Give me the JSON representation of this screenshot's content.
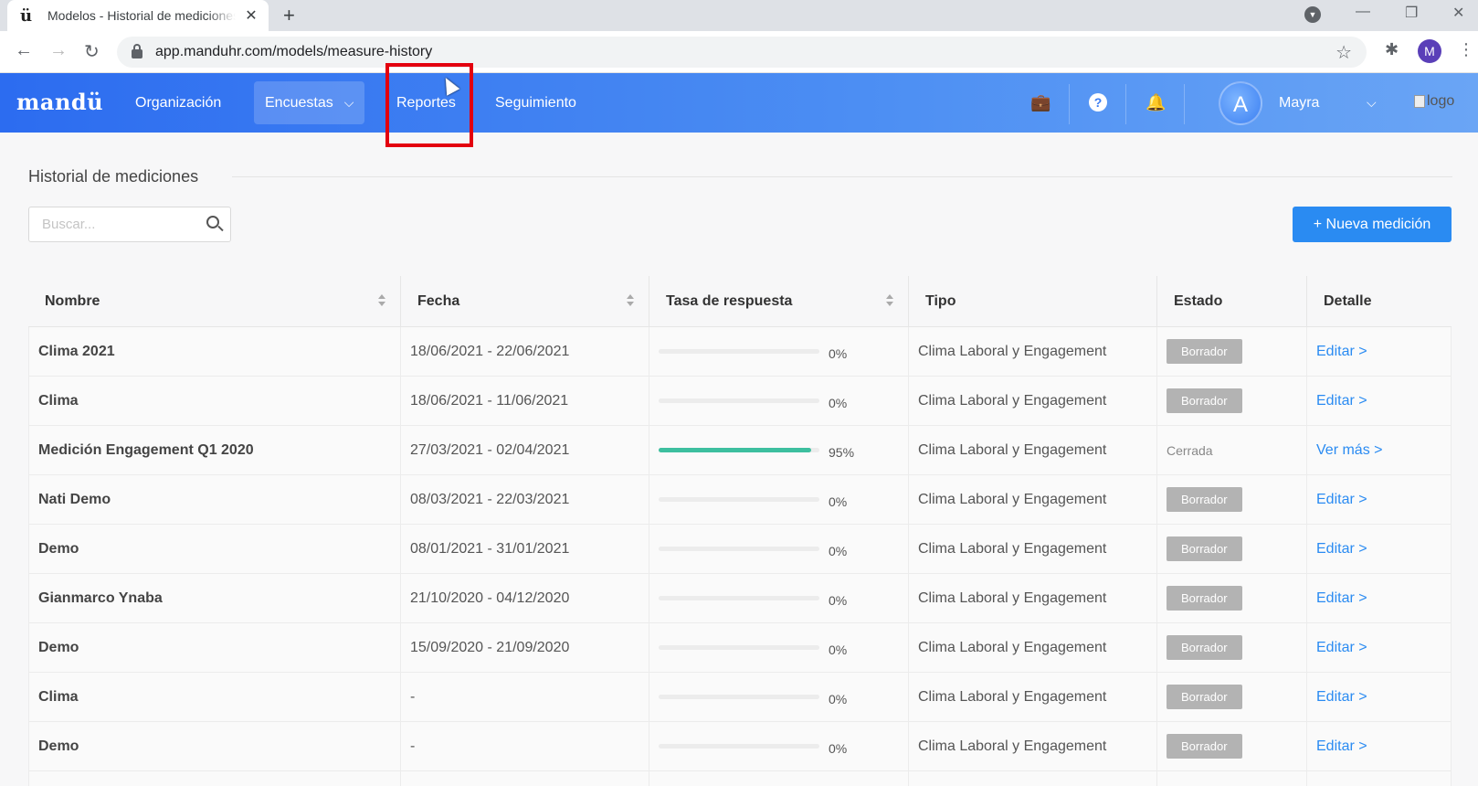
{
  "browser": {
    "tab_title": "Modelos - Historial de mediciones",
    "favicon": "ü",
    "url": "app.manduhr.com/models/measure-history",
    "profile_initial": "M"
  },
  "app": {
    "logo": "mandü",
    "nav": [
      {
        "label": "Organización"
      },
      {
        "label": "Encuestas"
      },
      {
        "label": "Reportes"
      },
      {
        "label": "Seguimiento"
      }
    ],
    "user": {
      "initial": "A",
      "name": "Mayra"
    },
    "broken_logo_alt": "logo"
  },
  "page": {
    "title": "Historial de mediciones",
    "search_placeholder": "Buscar...",
    "new_button": "+ Nueva medición"
  },
  "table": {
    "headers": [
      "Nombre",
      "Fecha",
      "Tasa de respuesta",
      "Tipo",
      "Estado",
      "Detalle"
    ],
    "rows": [
      {
        "name": "Clima 2021",
        "date": "18/06/2021 - 22/06/2021",
        "rate": 0,
        "rate_label": "0%",
        "type": "Clima Laboral y Engagement",
        "status": "Borrador",
        "detail": "Editar >"
      },
      {
        "name": "Clima",
        "date": "18/06/2021 - 11/06/2021",
        "rate": 0,
        "rate_label": "0%",
        "type": "Clima Laboral y Engagement",
        "status": "Borrador",
        "detail": "Editar >"
      },
      {
        "name": "Medición Engagement Q1 2020",
        "date": "27/03/2021 - 02/04/2021",
        "rate": 95,
        "rate_label": "95%",
        "type": "Clima Laboral y Engagement",
        "status": "Cerrada",
        "detail": "Ver más >"
      },
      {
        "name": "Nati Demo",
        "date": "08/03/2021 - 22/03/2021",
        "rate": 0,
        "rate_label": "0%",
        "type": "Clima Laboral y Engagement",
        "status": "Borrador",
        "detail": "Editar >"
      },
      {
        "name": "Demo",
        "date": "08/01/2021 - 31/01/2021",
        "rate": 0,
        "rate_label": "0%",
        "type": "Clima Laboral y Engagement",
        "status": "Borrador",
        "detail": "Editar >"
      },
      {
        "name": "Gianmarco Ynaba",
        "date": "21/10/2020 - 04/12/2020",
        "rate": 0,
        "rate_label": "0%",
        "type": "Clima Laboral y Engagement",
        "status": "Borrador",
        "detail": "Editar >"
      },
      {
        "name": "Demo",
        "date": "15/09/2020 - 21/09/2020",
        "rate": 0,
        "rate_label": "0%",
        "type": "Clima Laboral y Engagement",
        "status": "Borrador",
        "detail": "Editar >"
      },
      {
        "name": "Clima",
        "date": "-",
        "rate": 0,
        "rate_label": "0%",
        "type": "Clima Laboral y Engagement",
        "status": "Borrador",
        "detail": "Editar >"
      },
      {
        "name": "Demo",
        "date": "-",
        "rate": 0,
        "rate_label": "0%",
        "type": "Clima Laboral y Engagement",
        "status": "Borrador",
        "detail": "Editar >"
      }
    ]
  },
  "colors": {
    "accent": "#2a8bf2",
    "progress": "#3dbf9f",
    "badge": "#b3b3b3",
    "highlight": "#e3000f"
  }
}
